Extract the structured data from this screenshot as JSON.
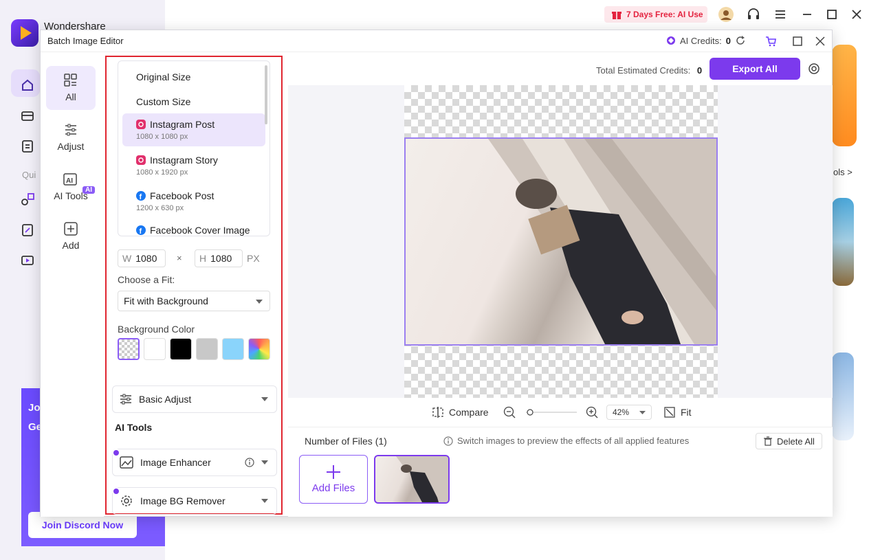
{
  "background_app": {
    "brand": "Wondershare",
    "quick_label": "Qui",
    "tools_link": "ols >",
    "promo": {
      "line1": "Jo",
      "line2": "Ge",
      "button": "Join Discord Now"
    },
    "trial_badge": "7 Days Free: AI Use",
    "icons": [
      "gift-icon",
      "avatar",
      "headset-icon",
      "menu-icon",
      "minimize-icon",
      "maximize-icon",
      "close-icon"
    ]
  },
  "dialog": {
    "title": "Batch Image Editor",
    "ai_credits_label": "AI Credits:",
    "ai_credits_value": "0",
    "total_credits_label": "Total Estimated Credits:",
    "total_credits_value": "0",
    "export_label": "Export All"
  },
  "left_nav": [
    {
      "label": "All",
      "icon": "grid-icon",
      "active": true
    },
    {
      "label": "Adjust",
      "icon": "sliders-icon"
    },
    {
      "label": "AI Tools",
      "icon": "ai-icon",
      "badge": "AI"
    },
    {
      "label": "Add",
      "icon": "plus-square-icon"
    }
  ],
  "size_presets": [
    {
      "label": "Original Size"
    },
    {
      "label": "Custom Size"
    },
    {
      "label": "Instagram Post",
      "size": "1080 x 1080 px",
      "icon": "instagram-icon",
      "selected": true
    },
    {
      "label": "Instagram Story",
      "size": "1080 x 1920 px",
      "icon": "instagram-icon"
    },
    {
      "label": "Facebook Post",
      "size": "1200 x 630 px",
      "icon": "facebook-icon"
    },
    {
      "label": "Facebook Cover Image",
      "icon": "facebook-icon"
    }
  ],
  "dimensions": {
    "w_label": "W",
    "w_value": "1080",
    "times": "×",
    "h_label": "H",
    "h_value": "1080",
    "unit": "PX"
  },
  "fit": {
    "label": "Choose a Fit:",
    "value": "Fit with Background"
  },
  "background_color": {
    "label": "Background Color",
    "swatches": [
      "transparent",
      "#ffffff",
      "#000000",
      "#c8c8c8",
      "#8ad4fb",
      "gradient"
    ]
  },
  "basic_adjust_label": "Basic Adjust",
  "ai_tools_title": "AI Tools",
  "image_enhancer_label": "Image Enhancer",
  "bg_remover_label": "Image BG Remover",
  "controls": {
    "compare_label": "Compare",
    "zoom_value": "42%",
    "fit_label": "Fit"
  },
  "files": {
    "count_label": "Number of Files (1)",
    "hint": "Switch images to preview the effects of all applied features",
    "delete_all": "Delete All",
    "add_files": "Add Files"
  }
}
